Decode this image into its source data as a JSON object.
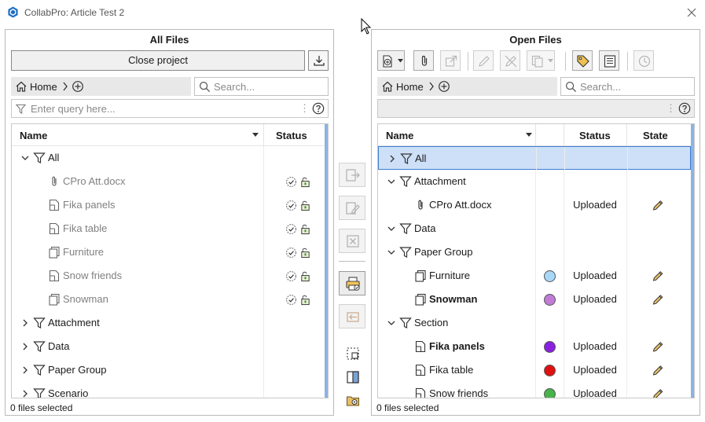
{
  "window": {
    "title": "CollabPro: Article Test 2"
  },
  "left": {
    "title": "All Files",
    "close_project_label": "Close project",
    "breadcrumb_home": "Home",
    "search_placeholder": "Search...",
    "query_placeholder": "Enter query here...",
    "columns": {
      "name": "Name",
      "status": "Status"
    },
    "rows": [
      {
        "label": "All",
        "type": "filter",
        "expanded": true,
        "level": 0
      },
      {
        "label": "CPro Att.docx",
        "type": "attachment",
        "level": 1,
        "grey": true
      },
      {
        "label": "Fika panels",
        "type": "drawing",
        "level": 1,
        "grey": true
      },
      {
        "label": "Fika table",
        "type": "drawing",
        "level": 1,
        "grey": true
      },
      {
        "label": "Furniture",
        "type": "group",
        "level": 1,
        "grey": true
      },
      {
        "label": "Snow friends",
        "type": "drawing",
        "level": 1,
        "grey": true
      },
      {
        "label": "Snowman",
        "type": "group",
        "level": 1,
        "grey": true
      },
      {
        "label": "Attachment",
        "type": "filter",
        "expanded": false,
        "level": 0
      },
      {
        "label": "Data",
        "type": "filter",
        "expanded": false,
        "level": 0
      },
      {
        "label": "Paper Group",
        "type": "filter",
        "expanded": false,
        "level": 0
      },
      {
        "label": "Scenario",
        "type": "filter",
        "expanded": false,
        "level": 0
      }
    ],
    "footer": "0 files selected"
  },
  "right": {
    "title": "Open Files",
    "breadcrumb_home": "Home",
    "search_placeholder": "Search...",
    "columns": {
      "name": "Name",
      "status": "Status",
      "state": "State"
    },
    "rows": [
      {
        "label": "All",
        "type": "filter",
        "expanded": false,
        "level": 0,
        "selected": true
      },
      {
        "label": "Attachment",
        "type": "filter",
        "expanded": true,
        "level": 0
      },
      {
        "label": "CPro Att.docx",
        "type": "attachment",
        "level": 1,
        "status": "Uploaded"
      },
      {
        "label": "Data",
        "type": "filter",
        "expanded": true,
        "level": 0
      },
      {
        "label": "Paper Group",
        "type": "filter",
        "expanded": true,
        "level": 0
      },
      {
        "label": "Furniture",
        "type": "group",
        "level": 1,
        "status": "Uploaded",
        "color": "#a8d8f8"
      },
      {
        "label": "Snowman",
        "type": "group",
        "level": 1,
        "status": "Uploaded",
        "color": "#c27bd6",
        "bold": true
      },
      {
        "label": "Section",
        "type": "filter",
        "expanded": true,
        "level": 0
      },
      {
        "label": "Fika panels",
        "type": "drawing",
        "level": 1,
        "status": "Uploaded",
        "color": "#8a1fe0",
        "bold": true
      },
      {
        "label": "Fika table",
        "type": "drawing",
        "level": 1,
        "status": "Uploaded",
        "color": "#e01010"
      },
      {
        "label": "Snow friends",
        "type": "drawing",
        "level": 1,
        "status": "Uploaded",
        "color": "#47b34a"
      }
    ],
    "footer": "0 files selected"
  }
}
